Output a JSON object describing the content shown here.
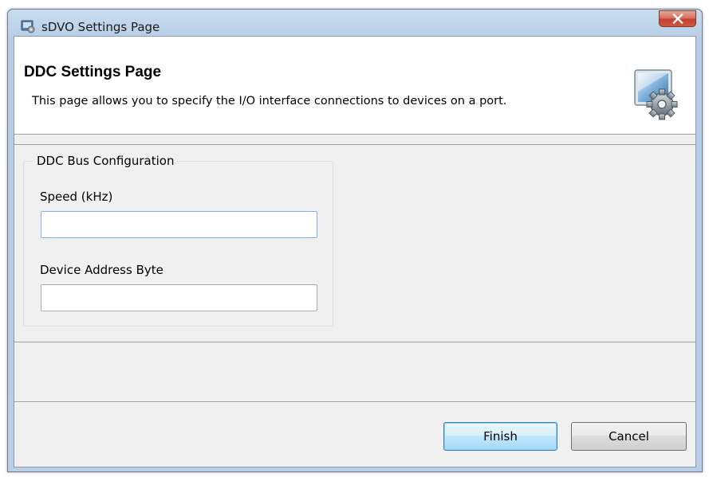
{
  "window": {
    "title": "sDVO Settings Page",
    "icon": "settings-app-icon",
    "close_icon": "close-icon"
  },
  "header": {
    "title": "DDC Settings Page",
    "description": "This page allows you to specify the I/O interface connections to devices on a port.",
    "graphic_icon": "gear-settings-icon"
  },
  "group": {
    "legend": "DDC Bus Configuration",
    "fields": [
      {
        "label": "Speed (kHz)",
        "value": "",
        "placeholder": ""
      },
      {
        "label": "Device Address Byte",
        "value": "",
        "placeholder": ""
      }
    ]
  },
  "buttons": {
    "finish_label": "Finish",
    "cancel_label": "Cancel"
  },
  "colors": {
    "titlebar": "#b9d1ea",
    "close_button": "#c7503c",
    "default_button_border": "#3c7fb1",
    "input_focus_border": "#7eb4ea"
  }
}
